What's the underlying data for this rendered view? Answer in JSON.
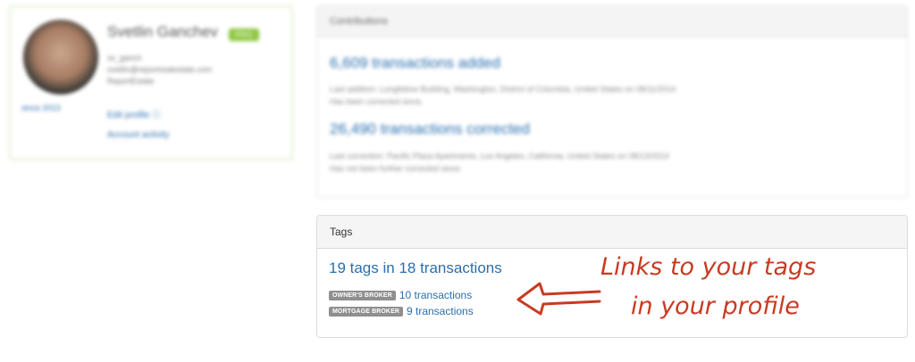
{
  "profile": {
    "name": "Svetlin Ganchev",
    "badge": "PRO",
    "username": "sv_ganch",
    "email": "svetlin@reportrealestate.com",
    "company": "ReportEstate",
    "user_since": "since 2013",
    "links": {
      "edit_profile": "Edit profile ⓘ",
      "account_activity": "Account activity"
    }
  },
  "contributions": {
    "title": "Contributions",
    "added": {
      "headline": "6,609 transactions added",
      "last_line": "Last addition: Longfellow Building, Washington, District of Columbia, United States on 08/11/2014",
      "note": "Has been corrected since."
    },
    "corrected": {
      "headline": "26,490 transactions corrected",
      "last_line": "Last correction: Pacific Plaza Apartments, Los Angeles, California, United States on 08/13/2014",
      "note": "Has not been further corrected since."
    }
  },
  "tags": {
    "title": "Tags",
    "summary": "19 tags in 18 transactions",
    "items": [
      {
        "label": "OWNER'S BROKER",
        "count": "10 transactions"
      },
      {
        "label": "MORTGAGE BROKER",
        "count": "9 transactions"
      }
    ]
  },
  "annotation": {
    "line1": "Links to your tags",
    "line2": "in your profile",
    "color": "#c83b22"
  }
}
